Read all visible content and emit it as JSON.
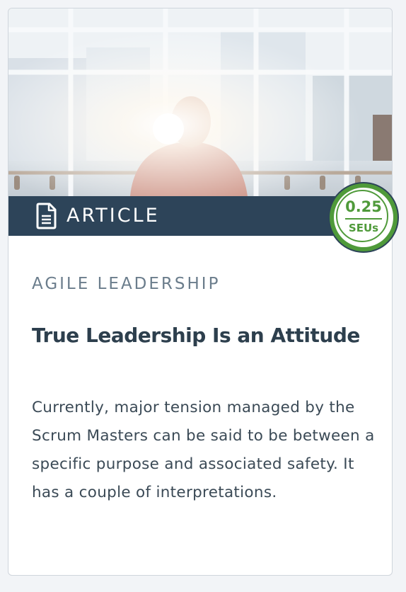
{
  "card": {
    "content_type": "ARTICLE",
    "type_icon": "document-icon",
    "seu": {
      "value": "0.25",
      "unit": "SEUs"
    },
    "category": "AGILE LEADERSHIP",
    "title": "True Leadership Is an Attitude",
    "description": "Currently, major tension managed by the Scrum Masters can be said to be between a specific purpose and associated safety. It has a couple of interpretations."
  },
  "colors": {
    "type_bar": "#2d4459",
    "seu_green": "#4f9a3a",
    "title": "#2d3f4d",
    "category": "#6b7d8c"
  }
}
